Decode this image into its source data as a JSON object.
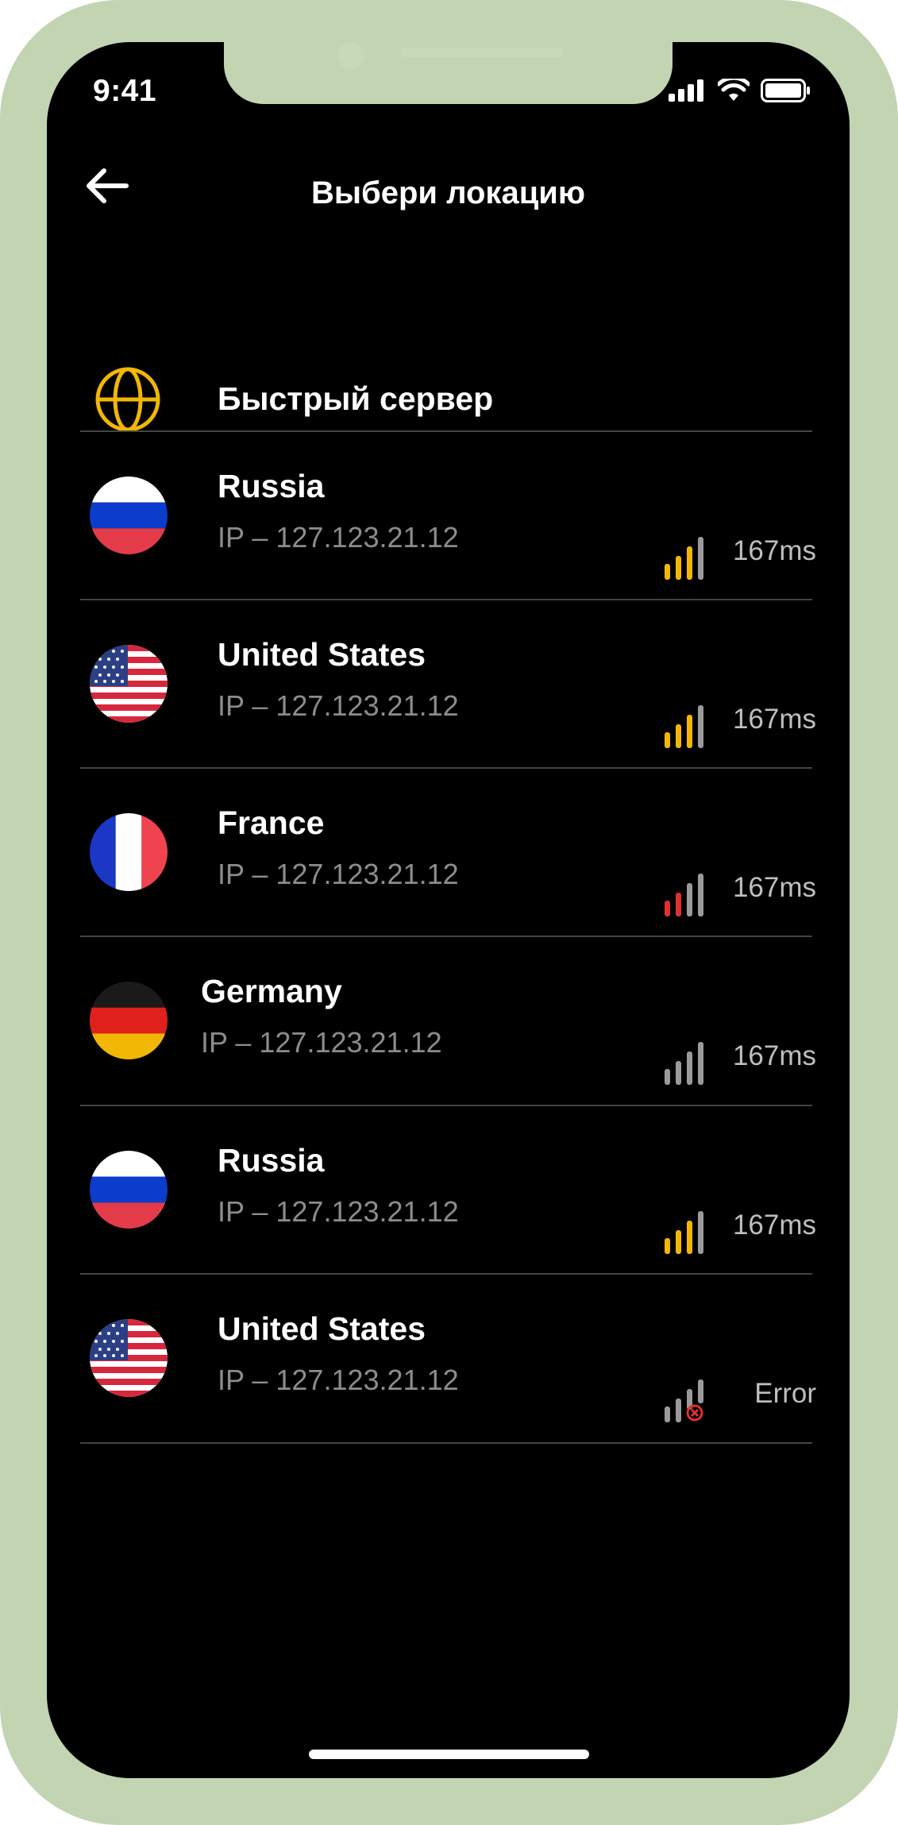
{
  "status_bar": {
    "time": "9:41"
  },
  "header": {
    "title": "Выбери локацию",
    "back_icon": "arrow-left-icon"
  },
  "fast_server": {
    "label": "Быстрый сервер",
    "icon": "globe-icon",
    "icon_color": "#f2b705"
  },
  "colors": {
    "bezel": "#c2d4b2",
    "signal_good": "#f2b705",
    "signal_bad": "#e03030",
    "signal_idle": "#9a9a9a"
  },
  "locations": [
    {
      "country": "Russia",
      "ip": "IP – 127.123.21.12",
      "ping": "167ms",
      "flag": "russia-flag-icon",
      "signal": "good"
    },
    {
      "country": "United States",
      "ip": "IP – 127.123.21.12",
      "ping": "167ms",
      "flag": "usa-flag-icon",
      "signal": "good"
    },
    {
      "country": "France",
      "ip": "IP – 127.123.21.12",
      "ping": "167ms",
      "flag": "france-flag-icon",
      "signal": "weak"
    },
    {
      "country": "Germany",
      "ip": "IP – 127.123.21.12",
      "ping": "167ms",
      "flag": "germany-flag-icon",
      "signal": "none"
    },
    {
      "country": "Russia",
      "ip": "IP – 127.123.21.12",
      "ping": "167ms",
      "flag": "russia-flag-icon",
      "signal": "good"
    },
    {
      "country": "United States",
      "ip": "IP – 127.123.21.12",
      "ping": "Error",
      "flag": "usa-flag-icon",
      "signal": "error"
    }
  ]
}
